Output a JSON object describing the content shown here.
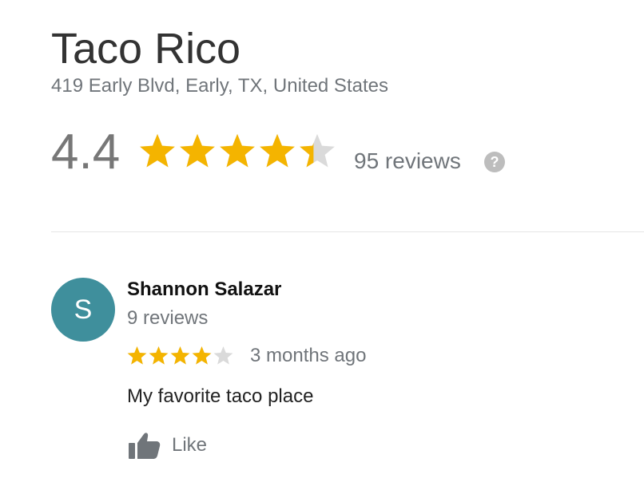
{
  "place": {
    "name": "Taco Rico",
    "address": "419 Early Blvd, Early, TX, United States",
    "rating": "4.4",
    "rating_value": 4.4,
    "review_count": "95 reviews",
    "help_icon": "?"
  },
  "review": {
    "avatar_letter": "S",
    "reviewer_name": "Shannon Salazar",
    "reviewer_review_count": "9 reviews",
    "rating_value": 4,
    "time": "3 months ago",
    "text": "My favorite taco place",
    "like_label": "Like"
  },
  "colors": {
    "star_filled": "#f4b400",
    "star_empty": "#dadada",
    "avatar_bg": "#3f8f9c",
    "muted_text": "#70757a"
  },
  "icons": {
    "star": "star-icon",
    "help": "help-icon",
    "like": "thumbs-up-icon"
  }
}
